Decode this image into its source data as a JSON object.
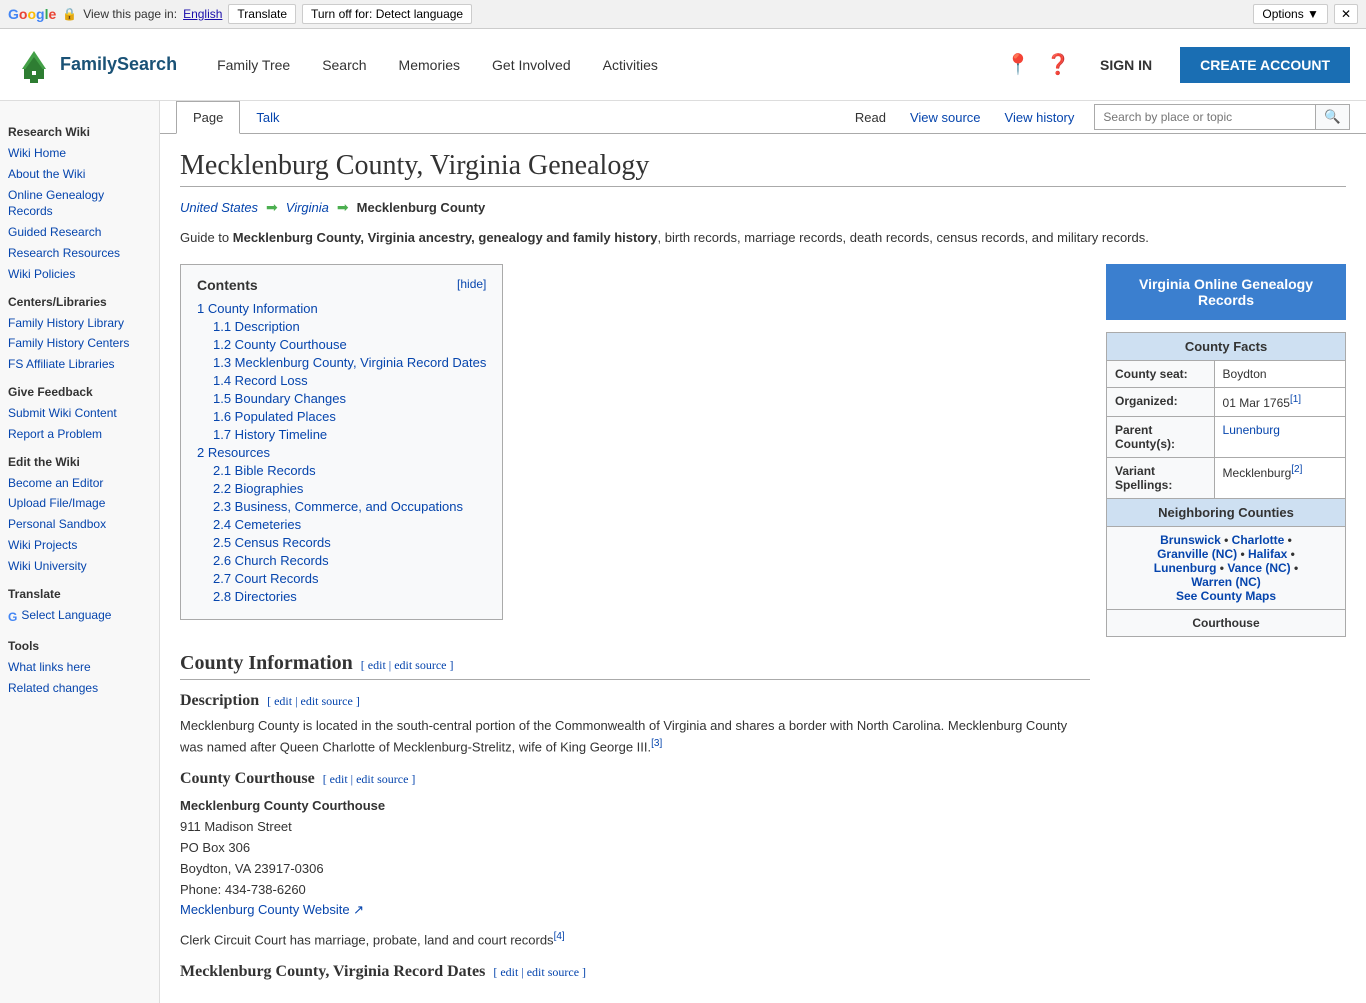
{
  "translate_bar": {
    "google_label": "Google",
    "view_page_label": "View this page in:",
    "language_link": "English",
    "translate_btn": "Translate",
    "turn_off_btn": "Turn off for: Detect language",
    "options_btn": "Options ▼",
    "close_btn": "✕"
  },
  "header": {
    "logo_alt": "FamilySearch",
    "nav": [
      "Family Tree",
      "Search",
      "Memories",
      "Get Involved",
      "Activities"
    ],
    "sign_in": "SIGN IN",
    "create_account": "CREATE ACCOUNT"
  },
  "sidebar": {
    "research_wiki_title": "Research Wiki",
    "links1": [
      "Wiki Home",
      "About the Wiki",
      "Online Genealogy Records",
      "Guided Research",
      "Research Resources",
      "Wiki Policies"
    ],
    "centers_title": "Centers/Libraries",
    "links2": [
      "Family History Library",
      "Family History Centers",
      "FS Affiliate Libraries"
    ],
    "feedback_title": "Give Feedback",
    "links3": [
      "Submit Wiki Content",
      "Report a Problem"
    ],
    "edit_title": "Edit the Wiki",
    "links4": [
      "Become an Editor",
      "Upload File/Image",
      "Personal Sandbox",
      "Wiki Projects",
      "Wiki University"
    ],
    "translate_title": "Translate",
    "select_language": "Select Language",
    "tools_title": "Tools",
    "links5": [
      "What links here",
      "Related changes"
    ]
  },
  "tabs": {
    "page_tab": "Page",
    "talk_tab": "Talk",
    "read_tab": "Read",
    "view_source_tab": "View source",
    "view_history_tab": "View history",
    "search_placeholder": "Search by place or topic"
  },
  "page": {
    "title": "Mecklenburg County, Virginia Genealogy",
    "breadcrumb": {
      "us": "United States",
      "state": "Virginia",
      "county": "Mecklenburg County"
    },
    "intro": "Guide to Mecklenburg County, Virginia ancestry, genealogy and family history, birth records, marriage records, death records, census records, and military records.",
    "contents": {
      "title": "Contents",
      "hide": "[hide]",
      "items": [
        {
          "num": "1",
          "label": "County Information",
          "indent": 0
        },
        {
          "num": "1.1",
          "label": "Description",
          "indent": 1
        },
        {
          "num": "1.2",
          "label": "County Courthouse",
          "indent": 1
        },
        {
          "num": "1.3",
          "label": "Mecklenburg County, Virginia Record Dates",
          "indent": 1
        },
        {
          "num": "1.4",
          "label": "Record Loss",
          "indent": 1
        },
        {
          "num": "1.5",
          "label": "Boundary Changes",
          "indent": 1
        },
        {
          "num": "1.6",
          "label": "Populated Places",
          "indent": 1
        },
        {
          "num": "1.7",
          "label": "History Timeline",
          "indent": 1
        },
        {
          "num": "2",
          "label": "Resources",
          "indent": 0
        },
        {
          "num": "2.1",
          "label": "Bible Records",
          "indent": 1
        },
        {
          "num": "2.2",
          "label": "Biographies",
          "indent": 1
        },
        {
          "num": "2.3",
          "label": "Business, Commerce, and Occupations",
          "indent": 1
        },
        {
          "num": "2.4",
          "label": "Cemeteries",
          "indent": 1
        },
        {
          "num": "2.5",
          "label": "Census Records",
          "indent": 1
        },
        {
          "num": "2.6",
          "label": "Church Records",
          "indent": 1
        },
        {
          "num": "2.7",
          "label": "Court Records",
          "indent": 1
        },
        {
          "num": "2.8",
          "label": "Directories",
          "indent": 1
        }
      ]
    },
    "county_info": {
      "section_title": "County Information",
      "edit": "[ edit | edit source ]",
      "description_title": "Description",
      "desc_edit": "[ edit | edit source ]",
      "description": "Mecklenburg County is located in the south-central portion of the Commonwealth of Virginia and shares a border with North Carolina. Mecklenburg County was named after Queen Charlotte of Mecklenburg-Strelitz, wife of King George III.",
      "ref3": "[3]",
      "courthouse_title": "County Courthouse",
      "courthouse_edit": "[ edit | edit source ]",
      "courthouse_name": "Mecklenburg County Courthouse",
      "address1": "911 Madison Street",
      "address2": "PO Box 306",
      "city_state_zip": "Boydton, VA 23917-0306",
      "phone": "Phone: 434-738-6260",
      "website_link": "Mecklenburg County Website",
      "clerk_info": "Clerk Circuit Court has marriage, probate, land and court records",
      "ref4": "[4]",
      "record_dates_title": "Mecklenburg County, Virginia Record Dates",
      "record_dates_edit": "[ edit | edit source ]"
    },
    "sidebar_box": {
      "btn_label": "Virginia Online Genealogy Records",
      "facts_title": "County Facts",
      "county_seat_label": "County seat:",
      "county_seat_val": "Boydton",
      "organized_label": "Organized:",
      "organized_val": "01 Mar 1765",
      "organized_ref": "[1]",
      "parent_label": "Parent County(s):",
      "parent_val": "Lunenburg",
      "variant_label": "Variant Spellings:",
      "variant_val": "Mecklenburg",
      "variant_ref": "[2]",
      "neighboring_title": "Neighboring Counties",
      "neighbors": "Brunswick • Charlotte • Granville (NC) • Halifax • Lunenburg • Vance (NC) • Warren (NC)",
      "see_maps": "See County Maps",
      "courthouse_title": "Courthouse"
    }
  }
}
